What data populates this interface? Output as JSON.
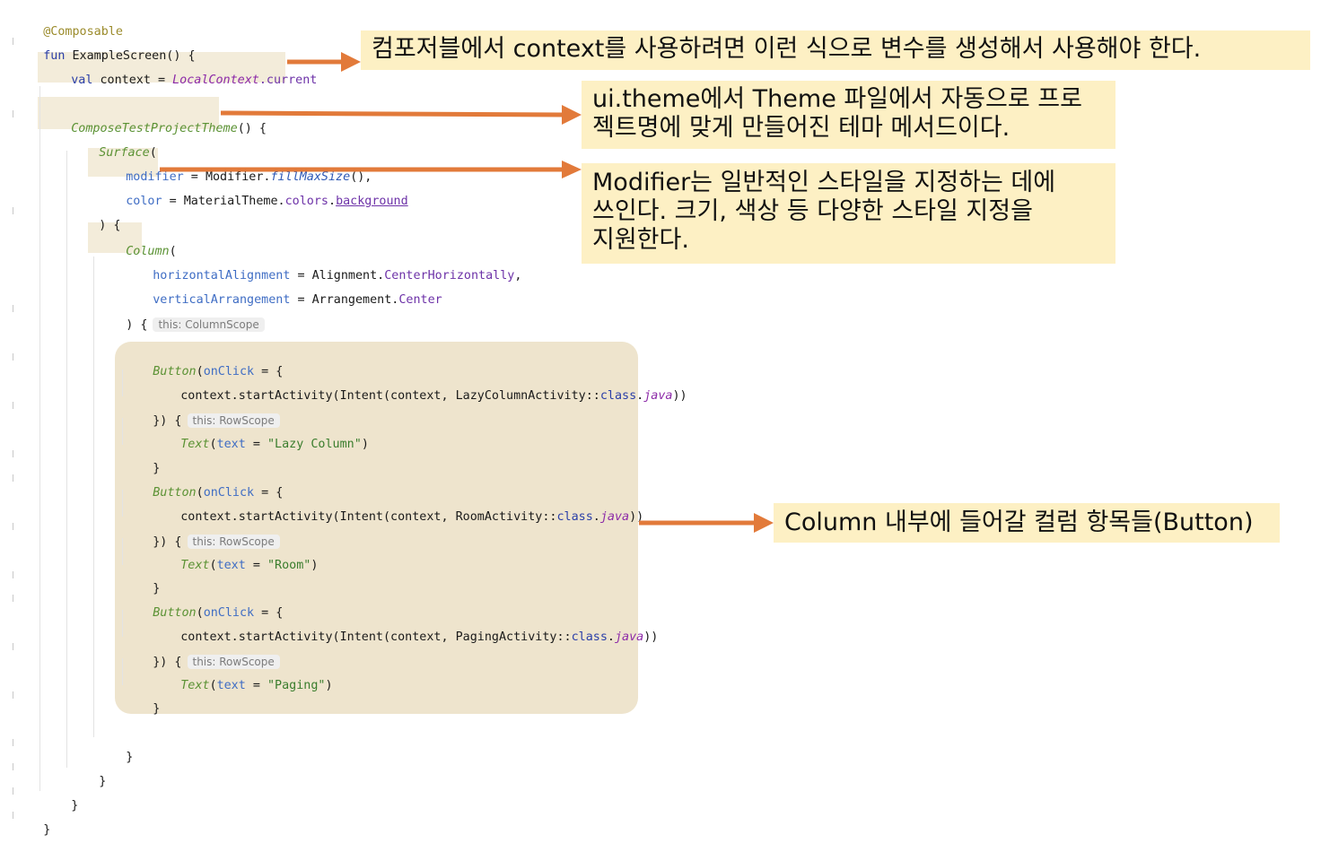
{
  "code": {
    "annotation": "@Composable",
    "fun_kw": "fun",
    "fun_name": "ExampleScreen() {",
    "val_kw": "val",
    "context_assign": " context = ",
    "local_context": "LocalContext",
    "current": ".current",
    "theme_call": "ComposeTestProjectTheme",
    "theme_paren": "() {",
    "surface": "Surface",
    "open_paren": "(",
    "modifier": "modifier",
    "eq": " = ",
    "modifier_value": "Modifier.",
    "fill_max_size": "fillMaxSize",
    "fill_tail": "(),",
    "color_param": "color",
    "material_theme": "MaterialTheme.",
    "colors": "colors",
    "dot": ".",
    "background": "background",
    "close_brace_paren": ") {",
    "column": "Column",
    "h_align": "horizontalAlignment",
    "alignment": "Alignment.",
    "center_horizontally": "CenterHorizontally",
    "comma": ",",
    "v_arr": "verticalArrangement",
    "arrangement": "Arrangement.",
    "center": "Center",
    "column_scope_hint": "this: ColumnScope",
    "button": "Button",
    "onclick": "onClick",
    "onclick_tail": " = {",
    "start_activity_1_pre": "context.startActivity(Intent(context, LazyColumnActivity::",
    "start_activity_2_pre": "context.startActivity(Intent(context, RoomActivity::",
    "start_activity_3_pre": "context.startActivity(Intent(context, PagingActivity::",
    "class_kw": "class",
    "java": "java",
    "close_double": "))",
    "lambda_close": "}) {",
    "row_scope_hint": "this: RowScope",
    "text_fn": "Text",
    "text_param": "text",
    "str_lazy": "\"Lazy Column\"",
    "str_room": "\"Room\"",
    "str_paging": "\"Paging\"",
    "close_paren": ")",
    "brace_close": "}"
  },
  "callouts": {
    "context": "컴포저블에서 context를 사용하려면 이런 식으로 변수를 생성해서 사용해야 한다.",
    "theme": "ui.theme에서 Theme 파일에서 자동으로 프로\n젝트명에 맞게 만들어진 테마 메서드이다.",
    "modifier": "Modifier는 일반적인 스타일을 지정하는 데에\n쓰인다. 크기, 색상 등 다양한 스타일 지정을\n지원한다.",
    "column_buttons": "Column 내부에 들어갈 컬럼 항목들(Button)"
  },
  "colors": {
    "arrow": "#e27a3a",
    "callout_bg": "#fdf0c4",
    "highlight_bg": "#f3ecda",
    "button_block_bg": "#eee4cd"
  }
}
